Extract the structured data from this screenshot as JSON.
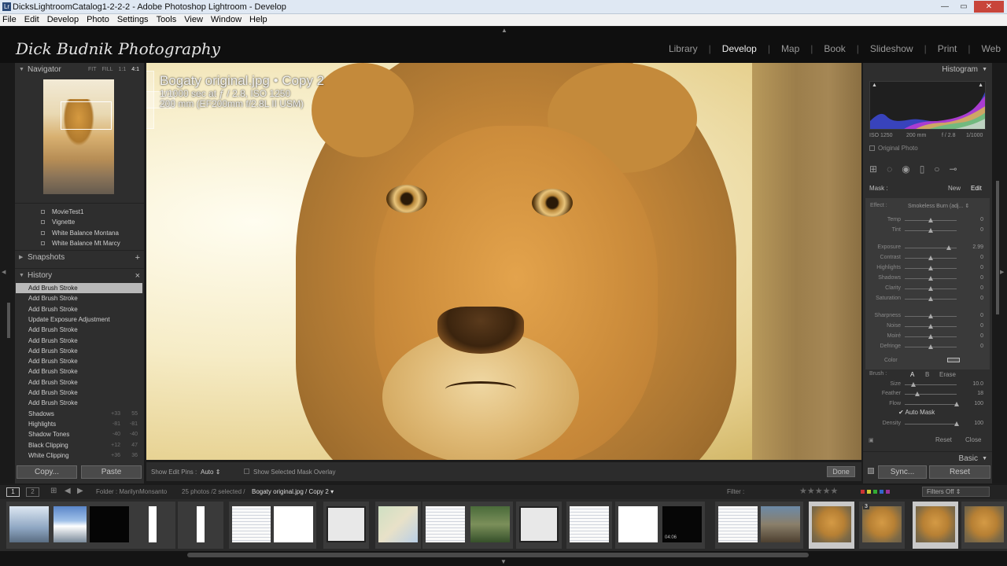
{
  "window": {
    "title": "DicksLightroomCatalog1-2-2-2 - Adobe Photoshop Lightroom - Develop"
  },
  "menu": [
    "File",
    "Edit",
    "Develop",
    "Photo",
    "Settings",
    "Tools",
    "View",
    "Window",
    "Help"
  ],
  "identity_plate": "Dick Budnik Photography",
  "modules": [
    {
      "label": "Library",
      "active": false
    },
    {
      "label": "Develop",
      "active": true
    },
    {
      "label": "Map",
      "active": false
    },
    {
      "label": "Book",
      "active": false
    },
    {
      "label": "Slideshow",
      "active": false
    },
    {
      "label": "Print",
      "active": false
    },
    {
      "label": "Web",
      "active": false
    }
  ],
  "navigator": {
    "title": "Navigator",
    "options": [
      "FIT",
      "FILL",
      "1:1",
      "4:1"
    ],
    "active_option": "4:1"
  },
  "presets": [
    "MovieTest1",
    "Vignette",
    "White Balance Montana",
    "White Balance Mt Marcy"
  ],
  "snapshots": {
    "title": "Snapshots",
    "add_icon": "+"
  },
  "history": {
    "title": "History",
    "close_icon": "×",
    "items": [
      {
        "label": "Add Brush Stroke",
        "v1": "",
        "v2": "",
        "selected": true
      },
      {
        "label": "Add Brush Stroke",
        "v1": "",
        "v2": ""
      },
      {
        "label": "Add Brush Stroke",
        "v1": "",
        "v2": ""
      },
      {
        "label": "Update Exposure Adjustment",
        "v1": "",
        "v2": ""
      },
      {
        "label": "Add Brush Stroke",
        "v1": "",
        "v2": ""
      },
      {
        "label": "Add Brush Stroke",
        "v1": "",
        "v2": ""
      },
      {
        "label": "Add Brush Stroke",
        "v1": "",
        "v2": ""
      },
      {
        "label": "Add Brush Stroke",
        "v1": "",
        "v2": ""
      },
      {
        "label": "Add Brush Stroke",
        "v1": "",
        "v2": ""
      },
      {
        "label": "Add Brush Stroke",
        "v1": "",
        "v2": ""
      },
      {
        "label": "Add Brush Stroke",
        "v1": "",
        "v2": ""
      },
      {
        "label": "Add Brush Stroke",
        "v1": "",
        "v2": ""
      },
      {
        "label": "Shadows",
        "v1": "+33",
        "v2": "55"
      },
      {
        "label": "Highlights",
        "v1": "-81",
        "v2": "-81"
      },
      {
        "label": "Shadow Tones",
        "v1": "-40",
        "v2": "-40"
      },
      {
        "label": "Black Clipping",
        "v1": "+12",
        "v2": "47"
      },
      {
        "label": "White Clipping",
        "v1": "+36",
        "v2": "36"
      }
    ]
  },
  "left_buttons": {
    "copy": "Copy...",
    "paste": "Paste"
  },
  "photo_info": {
    "title": "Bogaty original.jpg  •  Copy 2",
    "line2": "1/1000 sec at ƒ / 2.8, ISO 1250",
    "line3": "200 mm (EF200mm f/2.8L II USM)"
  },
  "toolbar": {
    "show_edit_pins_label": "Show Edit Pins :",
    "show_edit_pins_value": "Auto",
    "mask_overlay_label": "Show Selected Mask Overlay",
    "done": "Done"
  },
  "histogram": {
    "title": "Histogram",
    "iso": "ISO 1250",
    "focal": "200 mm",
    "aperture": "f / 2.8",
    "shutter": "1/1000",
    "original_photo": "Original Photo"
  },
  "mask": {
    "label": "Mask :",
    "new": "New",
    "edit": "Edit"
  },
  "effect": {
    "label": "Effect :",
    "value": "Smokeless Burn (adj..."
  },
  "sliders": [
    {
      "label": "Temp",
      "value": "0",
      "pos": 0.5
    },
    {
      "label": "Tint",
      "value": "0",
      "pos": 0.5
    },
    {
      "label": "Exposure",
      "value": "2.99",
      "pos": 0.85
    },
    {
      "label": "Contrast",
      "value": "0",
      "pos": 0.5
    },
    {
      "label": "Highlights",
      "value": "0",
      "pos": 0.5
    },
    {
      "label": "Shadows",
      "value": "0",
      "pos": 0.5
    },
    {
      "label": "Clarity",
      "value": "0",
      "pos": 0.5
    },
    {
      "label": "Saturation",
      "value": "0",
      "pos": 0.5
    },
    {
      "label": "Sharpness",
      "value": "0",
      "pos": 0.5
    },
    {
      "label": "Noise",
      "value": "0",
      "pos": 0.5
    },
    {
      "label": "Moiré",
      "value": "0",
      "pos": 0.5
    },
    {
      "label": "Defringe",
      "value": "0",
      "pos": 0.5
    }
  ],
  "color_label": "Color",
  "brush": {
    "label": "Brush :",
    "a": "A",
    "b": "B",
    "erase": "Erase",
    "size_label": "Size",
    "size": "10.0",
    "feather_label": "Feather",
    "feather": "18",
    "flow_label": "Flow",
    "flow": "100",
    "automask_label": "Auto Mask",
    "density_label": "Density",
    "density": "100",
    "reset": "Reset",
    "close": "Close"
  },
  "basic_title": "Basic",
  "right_buttons": {
    "sync": "Sync...",
    "reset": "Reset"
  },
  "filmbar": {
    "page1": "1",
    "page2": "2",
    "folder": "Folder : MarilynMonsanto",
    "count": "25 photos /2 selected /",
    "current": "Bogaty original.jpg / Copy 2",
    "filter_label": "Filter :",
    "filters_off": "Filters Off",
    "stars": "★★★★★"
  },
  "film_thumbnails": [
    {
      "kind": "snow"
    },
    {
      "kind": "mountain"
    },
    {
      "kind": "black"
    },
    {
      "kind": "white-narrow"
    },
    {
      "kind": "white-narrow"
    },
    {
      "kind": "document"
    },
    {
      "kind": "headphones"
    },
    {
      "kind": "screen"
    },
    {
      "kind": "map"
    },
    {
      "kind": "document"
    },
    {
      "kind": "forest"
    },
    {
      "kind": "screen"
    },
    {
      "kind": "document"
    },
    {
      "kind": "white"
    },
    {
      "kind": "video",
      "label": "04:06"
    },
    {
      "kind": "document"
    },
    {
      "kind": "crowd"
    },
    {
      "kind": "lion",
      "selected": true
    },
    {
      "kind": "lion",
      "badge": "3"
    },
    {
      "kind": "lion",
      "selected": true
    },
    {
      "kind": "lion"
    }
  ]
}
